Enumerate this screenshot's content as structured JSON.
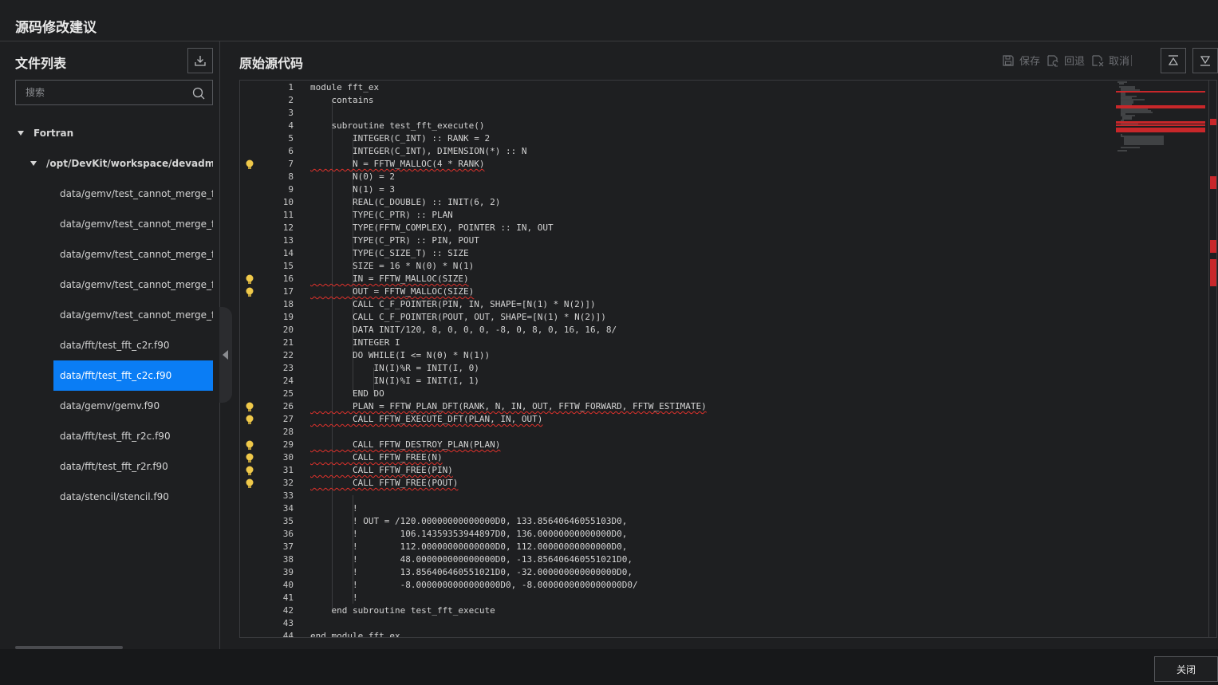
{
  "page": {
    "title": "源码修改建议"
  },
  "file_panel": {
    "title": "文件列表",
    "search_placeholder": "搜索",
    "groups": [
      {
        "label": "Fortran"
      },
      {
        "label": "/opt/DevKit/workspace/devadmin/at"
      }
    ],
    "files": [
      {
        "label": "data/gemv/test_cannot_merge_for_l"
      },
      {
        "label": "data/gemv/test_cannot_merge_for_i"
      },
      {
        "label": "data/gemv/test_cannot_merge_for_i"
      },
      {
        "label": "data/gemv/test_cannot_merge_for_c"
      },
      {
        "label": "data/gemv/test_cannot_merge_for_l"
      },
      {
        "label": "data/fft/test_fft_c2r.f90"
      },
      {
        "label": "data/fft/test_fft_c2c.f90",
        "selected": true
      },
      {
        "label": "data/gemv/gemv.f90"
      },
      {
        "label": "data/fft/test_fft_r2c.f90"
      },
      {
        "label": "data/fft/test_fft_r2r.f90"
      },
      {
        "label": "data/stencil/stencil.f90"
      }
    ]
  },
  "source_panel": {
    "title": "原始源代码",
    "save_label": "保存",
    "revert_label": "回退",
    "cancel_label": "取消"
  },
  "code": [
    {
      "n": "1",
      "text": "module fft_ex"
    },
    {
      "n": "2",
      "text": "    contains"
    },
    {
      "n": "3",
      "text": ""
    },
    {
      "n": "4",
      "text": "    subroutine test_fft_execute()"
    },
    {
      "n": "5",
      "text": "        INTEGER(C_INT) :: RANK = 2"
    },
    {
      "n": "6",
      "text": "        INTEGER(C_INT), DIMENSION(*) :: N"
    },
    {
      "n": "7",
      "text": "        N = FFTW_MALLOC(4 * RANK)",
      "hint": true
    },
    {
      "n": "8",
      "text": "        N(0) = 2"
    },
    {
      "n": "9",
      "text": "        N(1) = 3"
    },
    {
      "n": "10",
      "text": "        REAL(C_DOUBLE) :: INIT(6, 2)"
    },
    {
      "n": "11",
      "text": "        TYPE(C_PTR) :: PLAN"
    },
    {
      "n": "12",
      "text": "        TYPE(FFTW_COMPLEX), POINTER :: IN, OUT"
    },
    {
      "n": "13",
      "text": "        TYPE(C_PTR) :: PIN, POUT"
    },
    {
      "n": "14",
      "text": "        TYPE(C_SIZE_T) :: SIZE"
    },
    {
      "n": "15",
      "text": "        SIZE = 16 * N(0) * N(1)"
    },
    {
      "n": "16",
      "text": "        IN = FFTW_MALLOC(SIZE)",
      "hint": true
    },
    {
      "n": "17",
      "text": "        OUT = FFTW_MALLOC(SIZE)",
      "hint": true
    },
    {
      "n": "18",
      "text": "        CALL C_F_POINTER(PIN, IN, SHAPE=[N(1) * N(2)])"
    },
    {
      "n": "19",
      "text": "        CALL C_F_POINTER(POUT, OUT, SHAPE=[N(1) * N(2)])"
    },
    {
      "n": "20",
      "text": "        DATA INIT/120, 8, 0, 0, 0, -8, 0, 8, 0, 16, 16, 8/"
    },
    {
      "n": "21",
      "text": "        INTEGER I"
    },
    {
      "n": "22",
      "text": "        DO WHILE(I <= N(0) * N(1))"
    },
    {
      "n": "23",
      "text": "            IN(I)%R = INIT(I, 0)"
    },
    {
      "n": "24",
      "text": "            IN(I)%I = INIT(I, 1)"
    },
    {
      "n": "25",
      "text": "        END DO"
    },
    {
      "n": "26",
      "text": "        PLAN = FFTW_PLAN_DFT(RANK, N, IN, OUT, FFTW_FORWARD, FFTW_ESTIMATE)",
      "hint": true
    },
    {
      "n": "27",
      "text": "        CALL FFTW_EXECUTE_DFT(PLAN, IN, OUT)",
      "hint": true
    },
    {
      "n": "28",
      "text": ""
    },
    {
      "n": "29",
      "text": "        CALL FFTW_DESTROY_PLAN(PLAN)",
      "hint": true
    },
    {
      "n": "30",
      "text": "        CALL FFTW_FREE(N)",
      "hint": true
    },
    {
      "n": "31",
      "text": "        CALL FFTW_FREE(PIN)",
      "hint": true
    },
    {
      "n": "32",
      "text": "        CALL FFTW_FREE(POUT)",
      "hint": true
    },
    {
      "n": "33",
      "text": ""
    },
    {
      "n": "34",
      "text": "        !"
    },
    {
      "n": "35",
      "text": "        ! OUT = /120.00000000000000D0, 133.85640646055103D0,"
    },
    {
      "n": "36",
      "text": "        !        106.14359353944897D0, 136.00000000000000D0,"
    },
    {
      "n": "37",
      "text": "        !        112.00000000000000D0, 112.00000000000000D0,"
    },
    {
      "n": "38",
      "text": "        !        48.000000000000000D0, -13.856406460551021D0,"
    },
    {
      "n": "39",
      "text": "        !        13.856406460551021D0, -32.000000000000000D0,"
    },
    {
      "n": "40",
      "text": "        !        -8.0000000000000000D0, -8.0000000000000000D0/"
    },
    {
      "n": "41",
      "text": "        !"
    },
    {
      "n": "42",
      "text": "    end subroutine test_fft_execute"
    },
    {
      "n": "43",
      "text": ""
    },
    {
      "n": "44",
      "text": "end module fft_ex"
    }
  ],
  "footer": {
    "close_label": "关闭"
  },
  "colors": {
    "background": "#1e1f21",
    "selected": "#0a7df5",
    "error_underline": "#e0312b",
    "hint_bulb": "#f0c94a",
    "border": "#3a3b3e"
  }
}
